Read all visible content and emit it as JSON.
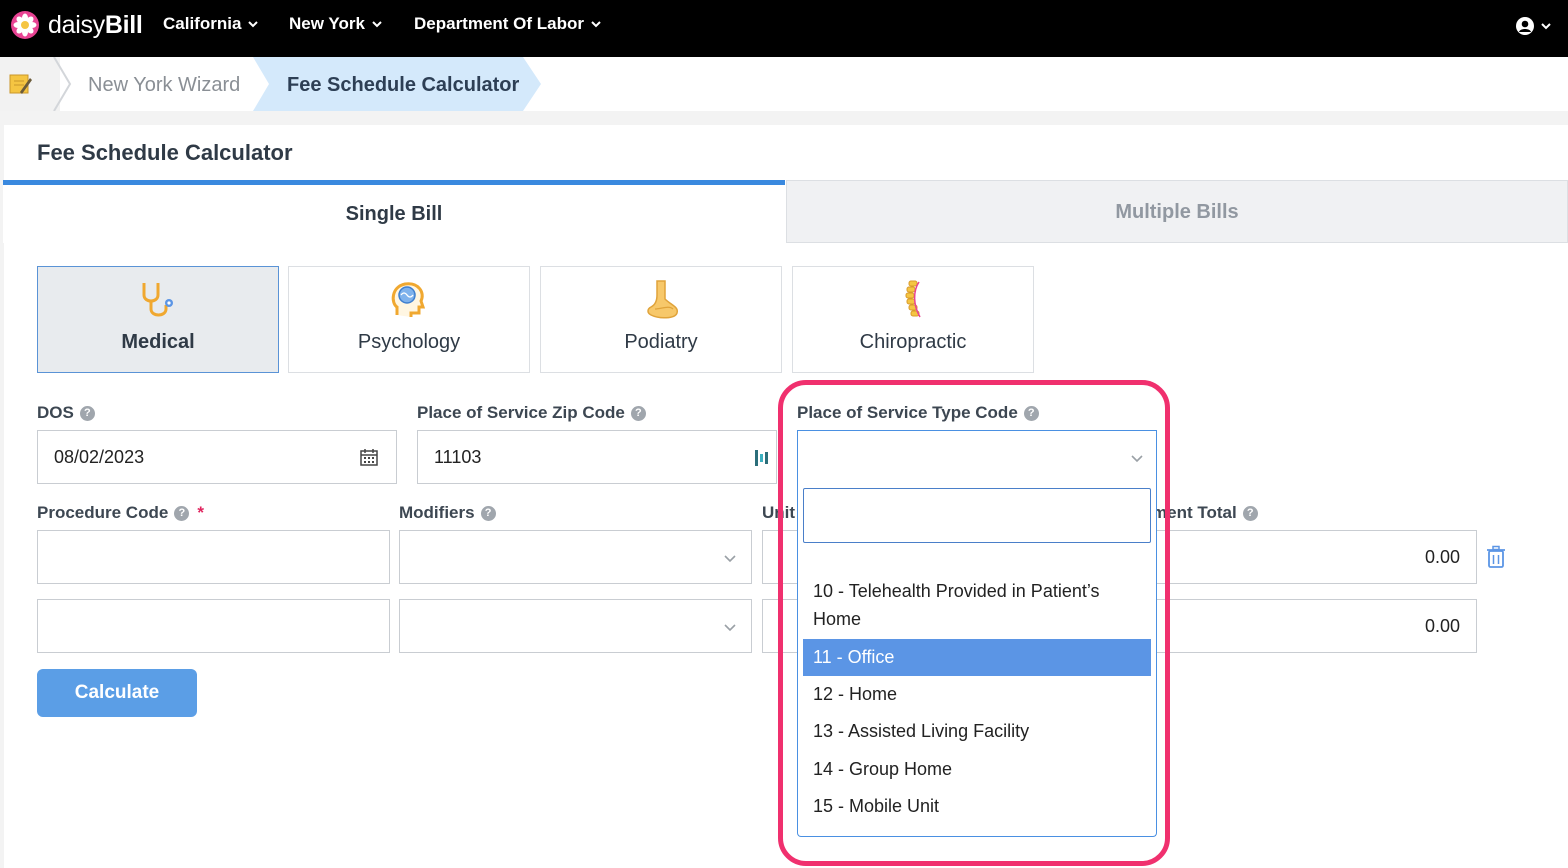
{
  "app": {
    "logo_part1": "daisy",
    "logo_part2": "Bill",
    "nav": [
      {
        "label": "California"
      },
      {
        "label": "New York"
      },
      {
        "label": "Department Of Labor"
      }
    ]
  },
  "breadcrumb": {
    "items": [
      "New York Wizard",
      "Fee Schedule Calculator"
    ]
  },
  "page": {
    "title": "Fee Schedule Calculator",
    "tabs": {
      "single": "Single Bill",
      "multiple": "Multiple Bills"
    },
    "types": [
      {
        "label": "Medical",
        "icon": "stethoscope-icon"
      },
      {
        "label": "Psychology",
        "icon": "brain-head-icon"
      },
      {
        "label": "Podiatry",
        "icon": "foot-icon"
      },
      {
        "label": "Chiropractic",
        "icon": "spine-icon"
      }
    ],
    "selected_type": "Medical"
  },
  "form": {
    "dos_label": "DOS",
    "dos_value": "08/02/2023",
    "zip_label": "Place of Service Zip Code",
    "zip_value": "11103",
    "pos_label": "Place of Service Type Code",
    "pos_value": "",
    "procedure_label": "Procedure Code",
    "required_mark": "*",
    "modifiers_label": "Modifiers",
    "units_label": "Unit",
    "total_label": "ment Total",
    "rows": [
      {
        "procedure": "",
        "modifiers": "",
        "total": "0.00"
      },
      {
        "procedure": "",
        "modifiers": "",
        "total": "0.00"
      }
    ],
    "calculate_label": "Calculate"
  },
  "dropdown": {
    "search_value": "",
    "options": [
      {
        "label": "10 - Telehealth Provided in Patient’s Home",
        "selected": false
      },
      {
        "label": "11 - Office",
        "selected": true
      },
      {
        "label": "12 - Home",
        "selected": false
      },
      {
        "label": "13 - Assisted Living Facility",
        "selected": false
      },
      {
        "label": "14 - Group Home",
        "selected": false
      },
      {
        "label": "15 - Mobile Unit",
        "selected": false
      }
    ]
  },
  "colors": {
    "accent": "#3a89df",
    "button": "#5b9ee6",
    "highlight_ring": "#f0306e",
    "selected_option": "#5b95e5"
  }
}
